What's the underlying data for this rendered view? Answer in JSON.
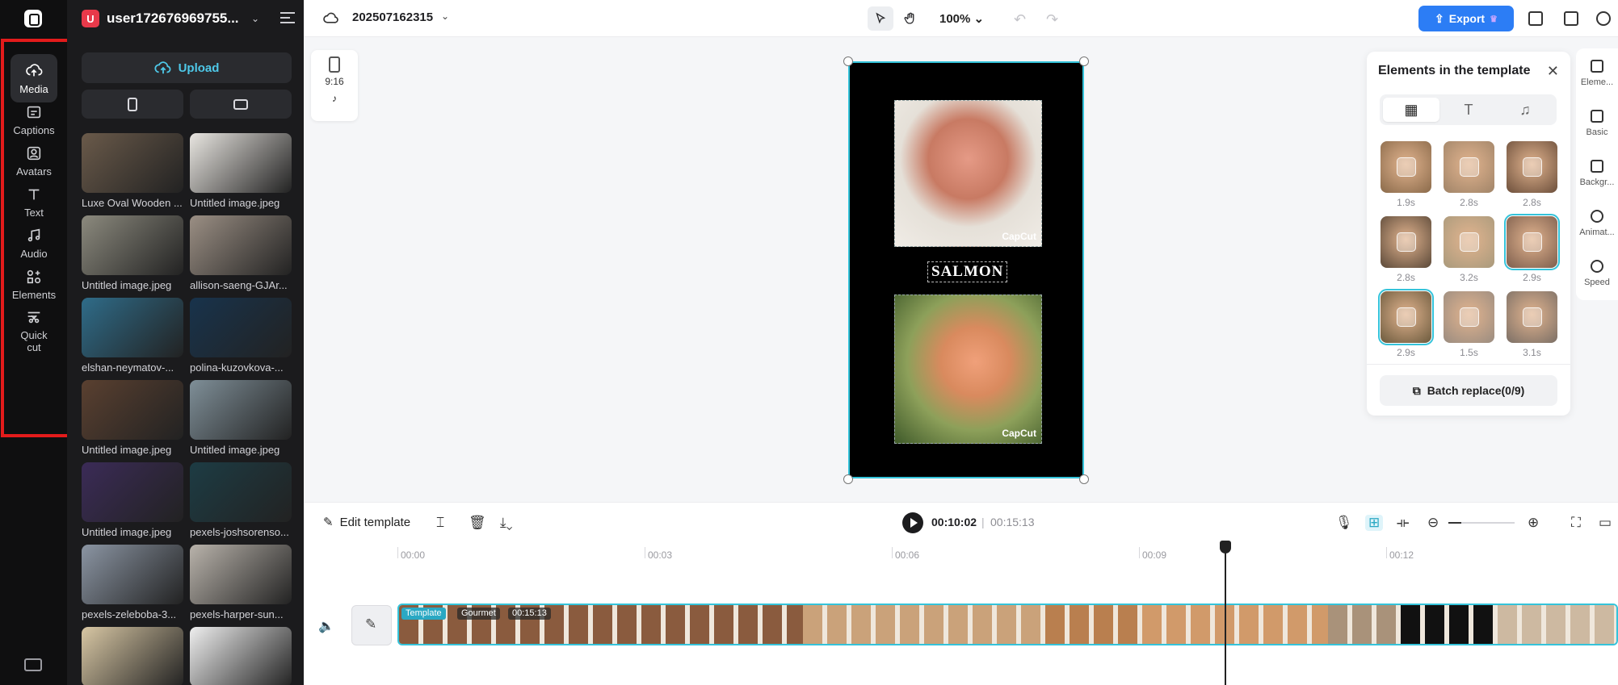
{
  "rail": {
    "items": [
      {
        "label": "Media",
        "icon": "cloud-upload-icon"
      },
      {
        "label": "Captions",
        "icon": "captions-icon"
      },
      {
        "label": "Avatars",
        "icon": "avatar-icon"
      },
      {
        "label": "Text",
        "icon": "text-icon"
      },
      {
        "label": "Audio",
        "icon": "music-note-icon"
      },
      {
        "label": "Elements",
        "icon": "elements-icon"
      },
      {
        "label": "Quick",
        "label2": "cut",
        "icon": "quick-cut-icon"
      }
    ],
    "highlight_color": "#e31b1b"
  },
  "media_panel": {
    "user_initial": "U",
    "user_name": "user172676969755...",
    "upload_label": "Upload",
    "items": [
      {
        "label": "Luxe Oval Wooden ...",
        "color": "#6a5a4a"
      },
      {
        "label": "Untitled image.jpeg",
        "color": "#e9e6e1"
      },
      {
        "label": "Untitled image.jpeg",
        "color": "#8c8a7e"
      },
      {
        "label": "allison-saeng-GJAr...",
        "color": "#9b8f84"
      },
      {
        "label": "elshan-neymatov-...",
        "color": "#2f6c89"
      },
      {
        "label": "polina-kuzovkova-...",
        "color": "#18334c"
      },
      {
        "label": "Untitled image.jpeg",
        "color": "#5a4030"
      },
      {
        "label": "Untitled image.jpeg",
        "color": "#7f8f98"
      },
      {
        "label": "Untitled image.jpeg",
        "color": "#3b2b57"
      },
      {
        "label": "pexels-joshsorenso...",
        "color": "#1d3c44"
      },
      {
        "label": "pexels-zeleboba-3...",
        "color": "#8b95a3"
      },
      {
        "label": "pexels-harper-sun...",
        "color": "#b9b3ab"
      },
      {
        "label": "",
        "color": "#d8c7a4"
      },
      {
        "label": "",
        "color": "#efefef"
      }
    ]
  },
  "topbar": {
    "project_name": "202507162315",
    "zoom": "100%",
    "export_label": "Export",
    "accent": "#2c7df5"
  },
  "canvas": {
    "ratio_label": "9:16",
    "title_text": "SALMON",
    "watermark": "CapCut"
  },
  "elements_panel": {
    "title": "Elements in the template",
    "clips": [
      {
        "duration": "1.9s"
      },
      {
        "duration": "2.8s"
      },
      {
        "duration": "2.8s"
      },
      {
        "duration": "2.8s"
      },
      {
        "duration": "3.2s"
      },
      {
        "duration": "2.9s"
      },
      {
        "duration": "2.9s"
      },
      {
        "duration": "1.5s"
      },
      {
        "duration": "3.1s"
      }
    ],
    "batch_label": "Batch replace(0/9)"
  },
  "properties": [
    {
      "label": "Eleme..."
    },
    {
      "label": "Basic"
    },
    {
      "label": "Backgr..."
    },
    {
      "label": "Animat..."
    },
    {
      "label": "Speed"
    }
  ],
  "timeline": {
    "edit_template_label": "Edit template",
    "current_time": "00:10:02",
    "separator": "|",
    "total_time": "00:15:13",
    "ruler": [
      "00:00",
      "00:03",
      "00:06",
      "00:09",
      "00:12"
    ],
    "track_chips": {
      "template": "Template",
      "name": "Gourmet",
      "duration": "00:15:13"
    }
  }
}
